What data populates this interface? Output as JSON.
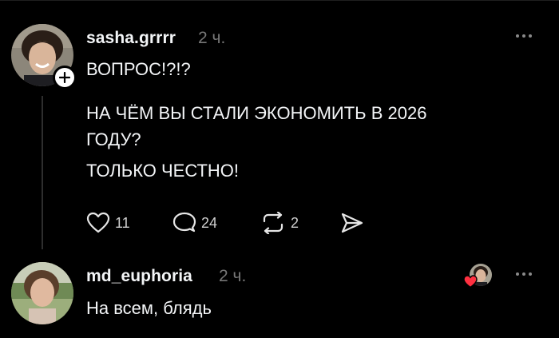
{
  "post": {
    "username": "sasha.grrrr",
    "time": "2 ч.",
    "line1": "ВОПРОС!?!?",
    "line2": "НА ЧЁМ ВЫ СТАЛИ ЭКОНОМИТЬ В 2026",
    "line3": "ГОДУ?",
    "line4": "ТОЛЬКО ЧЕСТНО!",
    "likes": "11",
    "comments": "24",
    "reposts": "2"
  },
  "reply": {
    "username": "md_euphoria",
    "time": "2 ч.",
    "text": "На всем, блядь"
  },
  "icons": {
    "follow": "plus-icon",
    "like": "heart-icon",
    "comment": "comment-icon",
    "repost": "repost-icon",
    "share": "send-icon",
    "more": "more-icon",
    "liked_by_author": "heart-badge-icon"
  },
  "colors": {
    "background": "#000000",
    "text": "#f3f5f7",
    "secondary": "#777777",
    "like_badge": "#ff3040"
  }
}
